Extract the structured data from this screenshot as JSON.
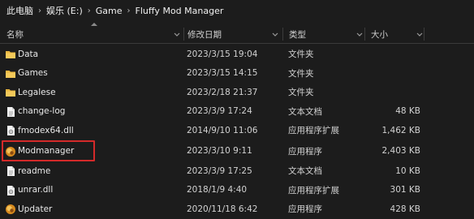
{
  "breadcrumb": {
    "items": [
      "此电脑",
      "娱乐 (E:)",
      "Game",
      "Fluffy Mod Manager"
    ],
    "separator": "›"
  },
  "columns": {
    "name": "名称",
    "date": "修改日期",
    "type": "类型",
    "size": "大小"
  },
  "files": [
    {
      "name": "Data",
      "date": "2023/3/15 19:04",
      "type": "文件夹",
      "size": "",
      "icon": "folder-icon"
    },
    {
      "name": "Games",
      "date": "2023/3/15 14:15",
      "type": "文件夹",
      "size": "",
      "icon": "folder-icon"
    },
    {
      "name": "Legalese",
      "date": "2023/2/18 21:37",
      "type": "文件夹",
      "size": "",
      "icon": "folder-icon"
    },
    {
      "name": "change-log",
      "date": "2023/3/9 17:24",
      "type": "文本文档",
      "size": "48 KB",
      "icon": "text-file-icon"
    },
    {
      "name": "fmodex64.dll",
      "date": "2014/9/10 11:06",
      "type": "应用程序扩展",
      "size": "1,462 KB",
      "icon": "dll-file-icon"
    },
    {
      "name": "Modmanager",
      "date": "2023/3/10 9:11",
      "type": "应用程序",
      "size": "2,403 KB",
      "icon": "app-icon"
    },
    {
      "name": "readme",
      "date": "2023/3/9 17:25",
      "type": "文本文档",
      "size": "10 KB",
      "icon": "text-file-icon"
    },
    {
      "name": "unrar.dll",
      "date": "2018/1/9 4:40",
      "type": "应用程序扩展",
      "size": "301 KB",
      "icon": "dll-file-icon"
    },
    {
      "name": "Updater",
      "date": "2020/11/18 6:42",
      "type": "应用程序",
      "size": "428 KB",
      "icon": "app-icon"
    }
  ],
  "highlighted_item": "Modmanager",
  "colors": {
    "background": "#1c1c1c",
    "folder": "#e8b53e",
    "highlight_border": "#d42a2a",
    "app_icon": "#d78a1e"
  }
}
